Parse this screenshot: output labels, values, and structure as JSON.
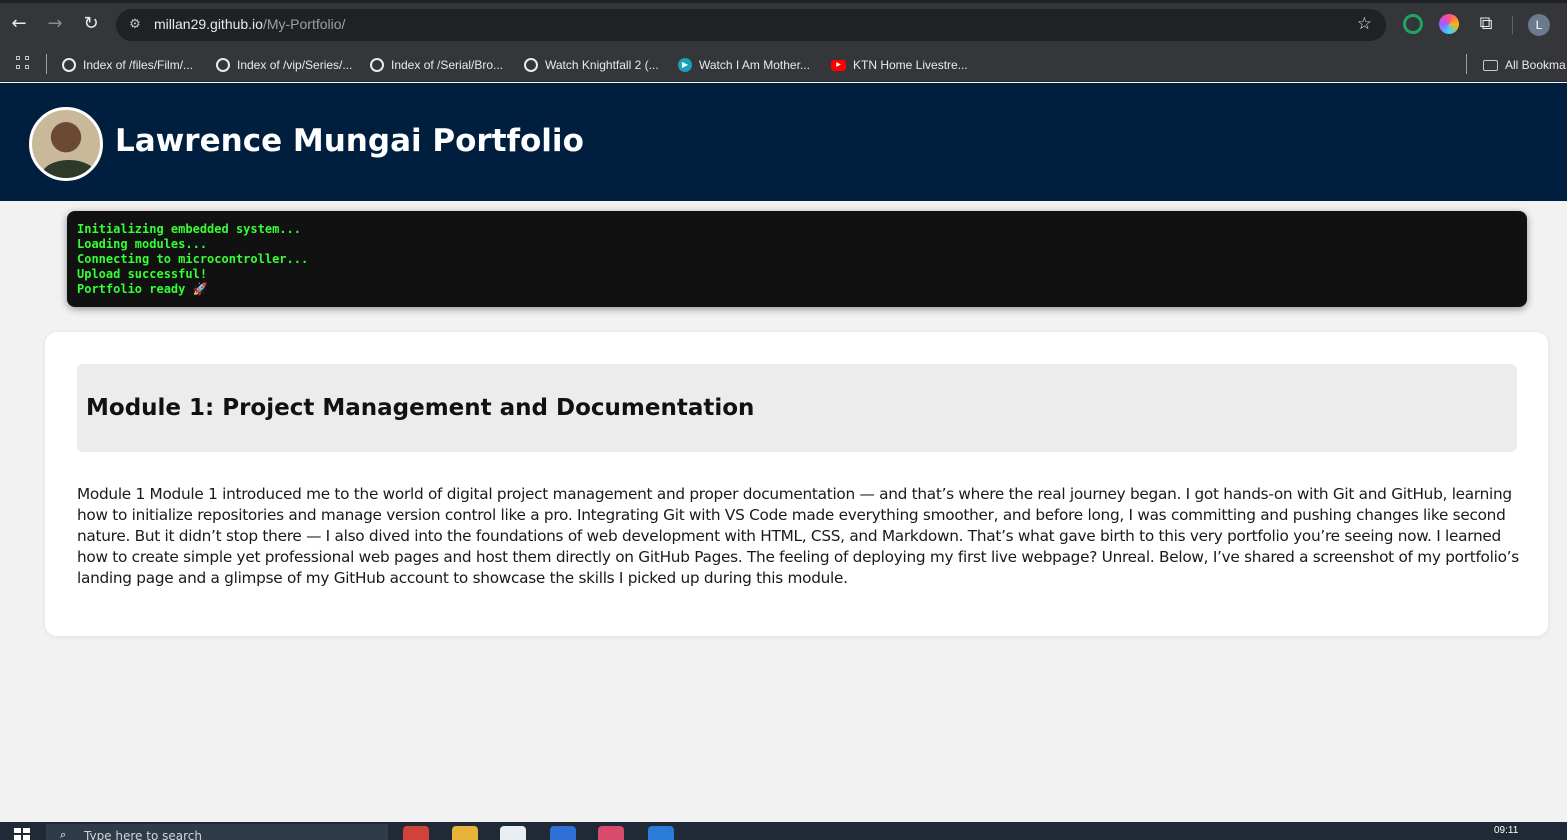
{
  "browser": {
    "url_domain": "millan29.github.io",
    "url_path": "/My-Portfolio/",
    "profile_initial": "L",
    "bookmarks": [
      {
        "label": "Index of /files/Film/...",
        "icon": "globe-icon"
      },
      {
        "label": "Index of /vip/Series/...",
        "icon": "globe-icon"
      },
      {
        "label": "Index of /Serial/Bro...",
        "icon": "globe-icon"
      },
      {
        "label": "Watch Knightfall 2 (...",
        "icon": "globe-icon"
      },
      {
        "label": "Watch I Am Mother...",
        "icon": "play-icon"
      },
      {
        "label": "KTN Home Livestre...",
        "icon": "youtube-icon"
      }
    ],
    "all_bookmarks_label": "All Bookma"
  },
  "header": {
    "title": "Lawrence Mungai Portfolio",
    "background": "#001f3f"
  },
  "terminal": {
    "lines": [
      "Initializing embedded system...",
      "Loading modules...",
      "Connecting to microcontroller...",
      "Upload successful!",
      "Portfolio ready 🚀"
    ],
    "text_color": "#33ff33"
  },
  "module": {
    "title": "Module 1: Project Management and Documentation",
    "body": "Module 1 Module 1 introduced me to the world of digital project management and proper documentation — and that’s where the real journey began. I got hands-on with Git and GitHub, learning how to initialize repositories and manage version control like a pro. Integrating Git with VS Code made everything smoother, and before long, I was committing and pushing changes like second nature. But it didn’t stop there — I also dived into the foundations of web development with HTML, CSS, and Markdown. That’s what gave birth to this very portfolio you’re seeing now. I learned how to create simple yet professional web pages and host them directly on GitHub Pages. The feeling of deploying my first live webpage? Unreal. Below, I’ve shared a screenshot of my portfolio’s landing page and a glimpse of my GitHub account to showcase the skills I picked up during this module."
  },
  "taskbar": {
    "search_placeholder": "Type here to search",
    "clock": "09:11"
  }
}
